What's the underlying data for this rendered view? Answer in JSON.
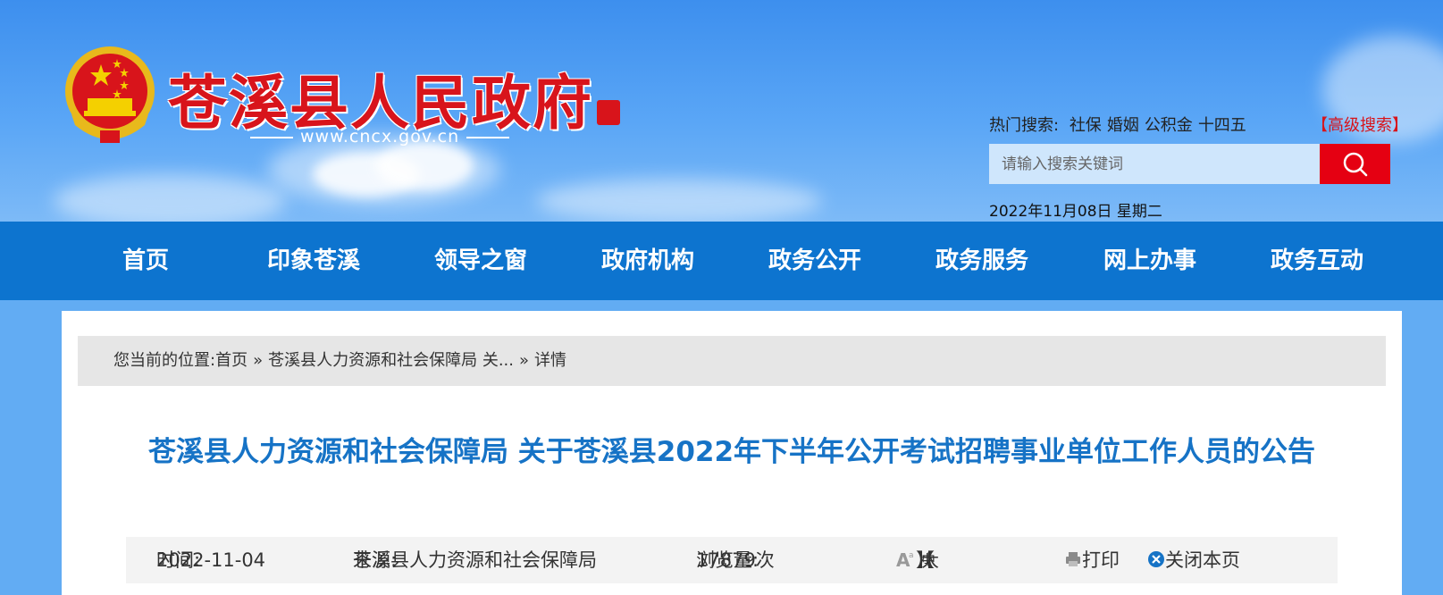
{
  "header": {
    "site_title": "苍溪县人民政府",
    "seal_text": "苍溪县",
    "site_url": "www.cncx.gov.cn",
    "hot_search_label": "热门搜索:",
    "hot_keywords": [
      "社保",
      "婚姻",
      "公积金",
      "十四五"
    ],
    "advanced_search": "【高级搜索】",
    "search_placeholder": "请输入搜索关键词",
    "date": "2022年11月08日 星期二"
  },
  "nav": {
    "items": [
      "首页",
      "印象苍溪",
      "领导之窗",
      "政府机构",
      "政务公开",
      "政务服务",
      "网上办事",
      "政务互动"
    ]
  },
  "breadcrumb": {
    "label": "您当前的位置:",
    "items": [
      "首页",
      "苍溪县人力资源和社会保障局 关...",
      "详情"
    ],
    "separator": "»"
  },
  "article": {
    "title": "苍溪县人力资源和社会保障局 关于苍溪县2022年下半年公开考试招聘事业单位工作人员的公告",
    "time_label": "时间:",
    "time": "2022-11-04",
    "source_label": "来源:",
    "source": "苍溪县人力资源和社会保障局",
    "views_label": "浏览量:",
    "views": "17879次",
    "font_size": {
      "open": "【",
      "large": "大",
      "medium": "中",
      "small": "小",
      "close": "】"
    },
    "print": "打印",
    "close_page": "关闭本页"
  },
  "colors": {
    "header_blue": "#3d8fee",
    "nav_blue": "#0d74cf",
    "title_red": "#d8141b",
    "search_red": "#e50012",
    "article_title_blue": "#1673c6"
  }
}
